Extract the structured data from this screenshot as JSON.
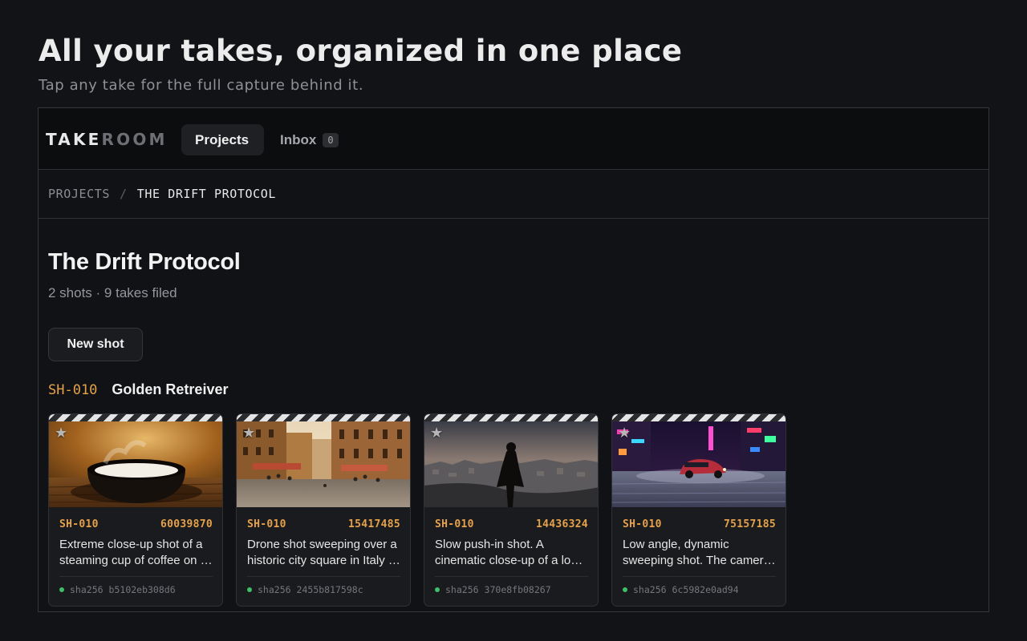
{
  "hero": {
    "title": "All your takes, organized in one place",
    "subtitle": "Tap any take for the full capture behind it."
  },
  "topbar": {
    "logo_primary": "TAKE",
    "logo_secondary": "ROOM",
    "tabs": [
      {
        "label": "Projects",
        "active": true
      },
      {
        "label": "Inbox",
        "count": "0"
      }
    ]
  },
  "breadcrumb": {
    "root": "PROJECTS",
    "separator": "/",
    "current": "THE DRIFT PROTOCOL"
  },
  "project": {
    "title": "The Drift Protocol",
    "meta": "2 shots · 9 takes filed",
    "new_shot_label": "New shot"
  },
  "shot": {
    "code": "SH-010",
    "name": "Golden Retreiver"
  },
  "takes": [
    {
      "shot": "SH-010",
      "id": "60039870",
      "desc": "Extreme close-up shot of a steaming cup of coffee on a rustic wooden table",
      "hash_label": "sha256",
      "hash": "b5102eb308d6",
      "image": "coffee-cup"
    },
    {
      "shot": "SH-010",
      "id": "15417485",
      "desc": "Drone shot sweeping over a historic city square in Italy at golden hour",
      "hash_label": "sha256",
      "hash": "2455b817598c",
      "image": "italian-piazza"
    },
    {
      "shot": "SH-010",
      "id": "14436324",
      "desc": "Slow push-in shot. A cinematic close-up of a lone figure overlooking a ruined city",
      "hash_label": "sha256",
      "hash": "370e8fb08267",
      "image": "cloaked-figure-city"
    },
    {
      "shot": "SH-010",
      "id": "75157185",
      "desc": "Low angle, dynamic sweeping shot. The camera tracks a sports car through neon streets",
      "hash_label": "sha256",
      "hash": "6c5982e0ad94",
      "image": "neon-street-car"
    }
  ],
  "colors": {
    "accent": "#e6a24a",
    "status_ok": "#3fbf6a",
    "background": "#121316"
  },
  "icons": {
    "star": "star-icon",
    "status": "status-dot-icon"
  }
}
